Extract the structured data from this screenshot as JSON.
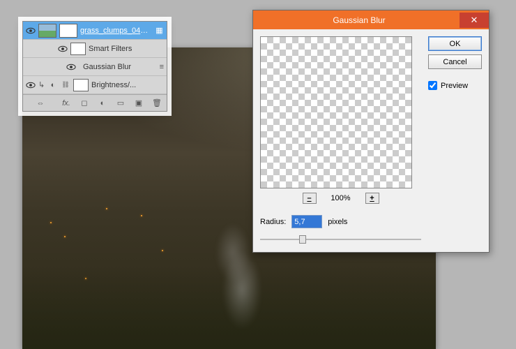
{
  "canvas": {},
  "layers": {
    "rows": [
      {
        "name": "grass_clumps_04_b..."
      },
      {
        "name": "Smart Filters"
      },
      {
        "name": "Gaussian Blur"
      },
      {
        "name": "Brightness/..."
      }
    ]
  },
  "dialog": {
    "title": "Gaussian Blur",
    "close": "✕",
    "ok": "OK",
    "cancel": "Cancel",
    "preview_label": "Preview",
    "preview_checked": true,
    "zoom_out": "–",
    "zoom_in": "+",
    "zoom_level": "100%",
    "radius_label": "Radius:",
    "radius_value": "5,7",
    "radius_unit": "pixels"
  }
}
